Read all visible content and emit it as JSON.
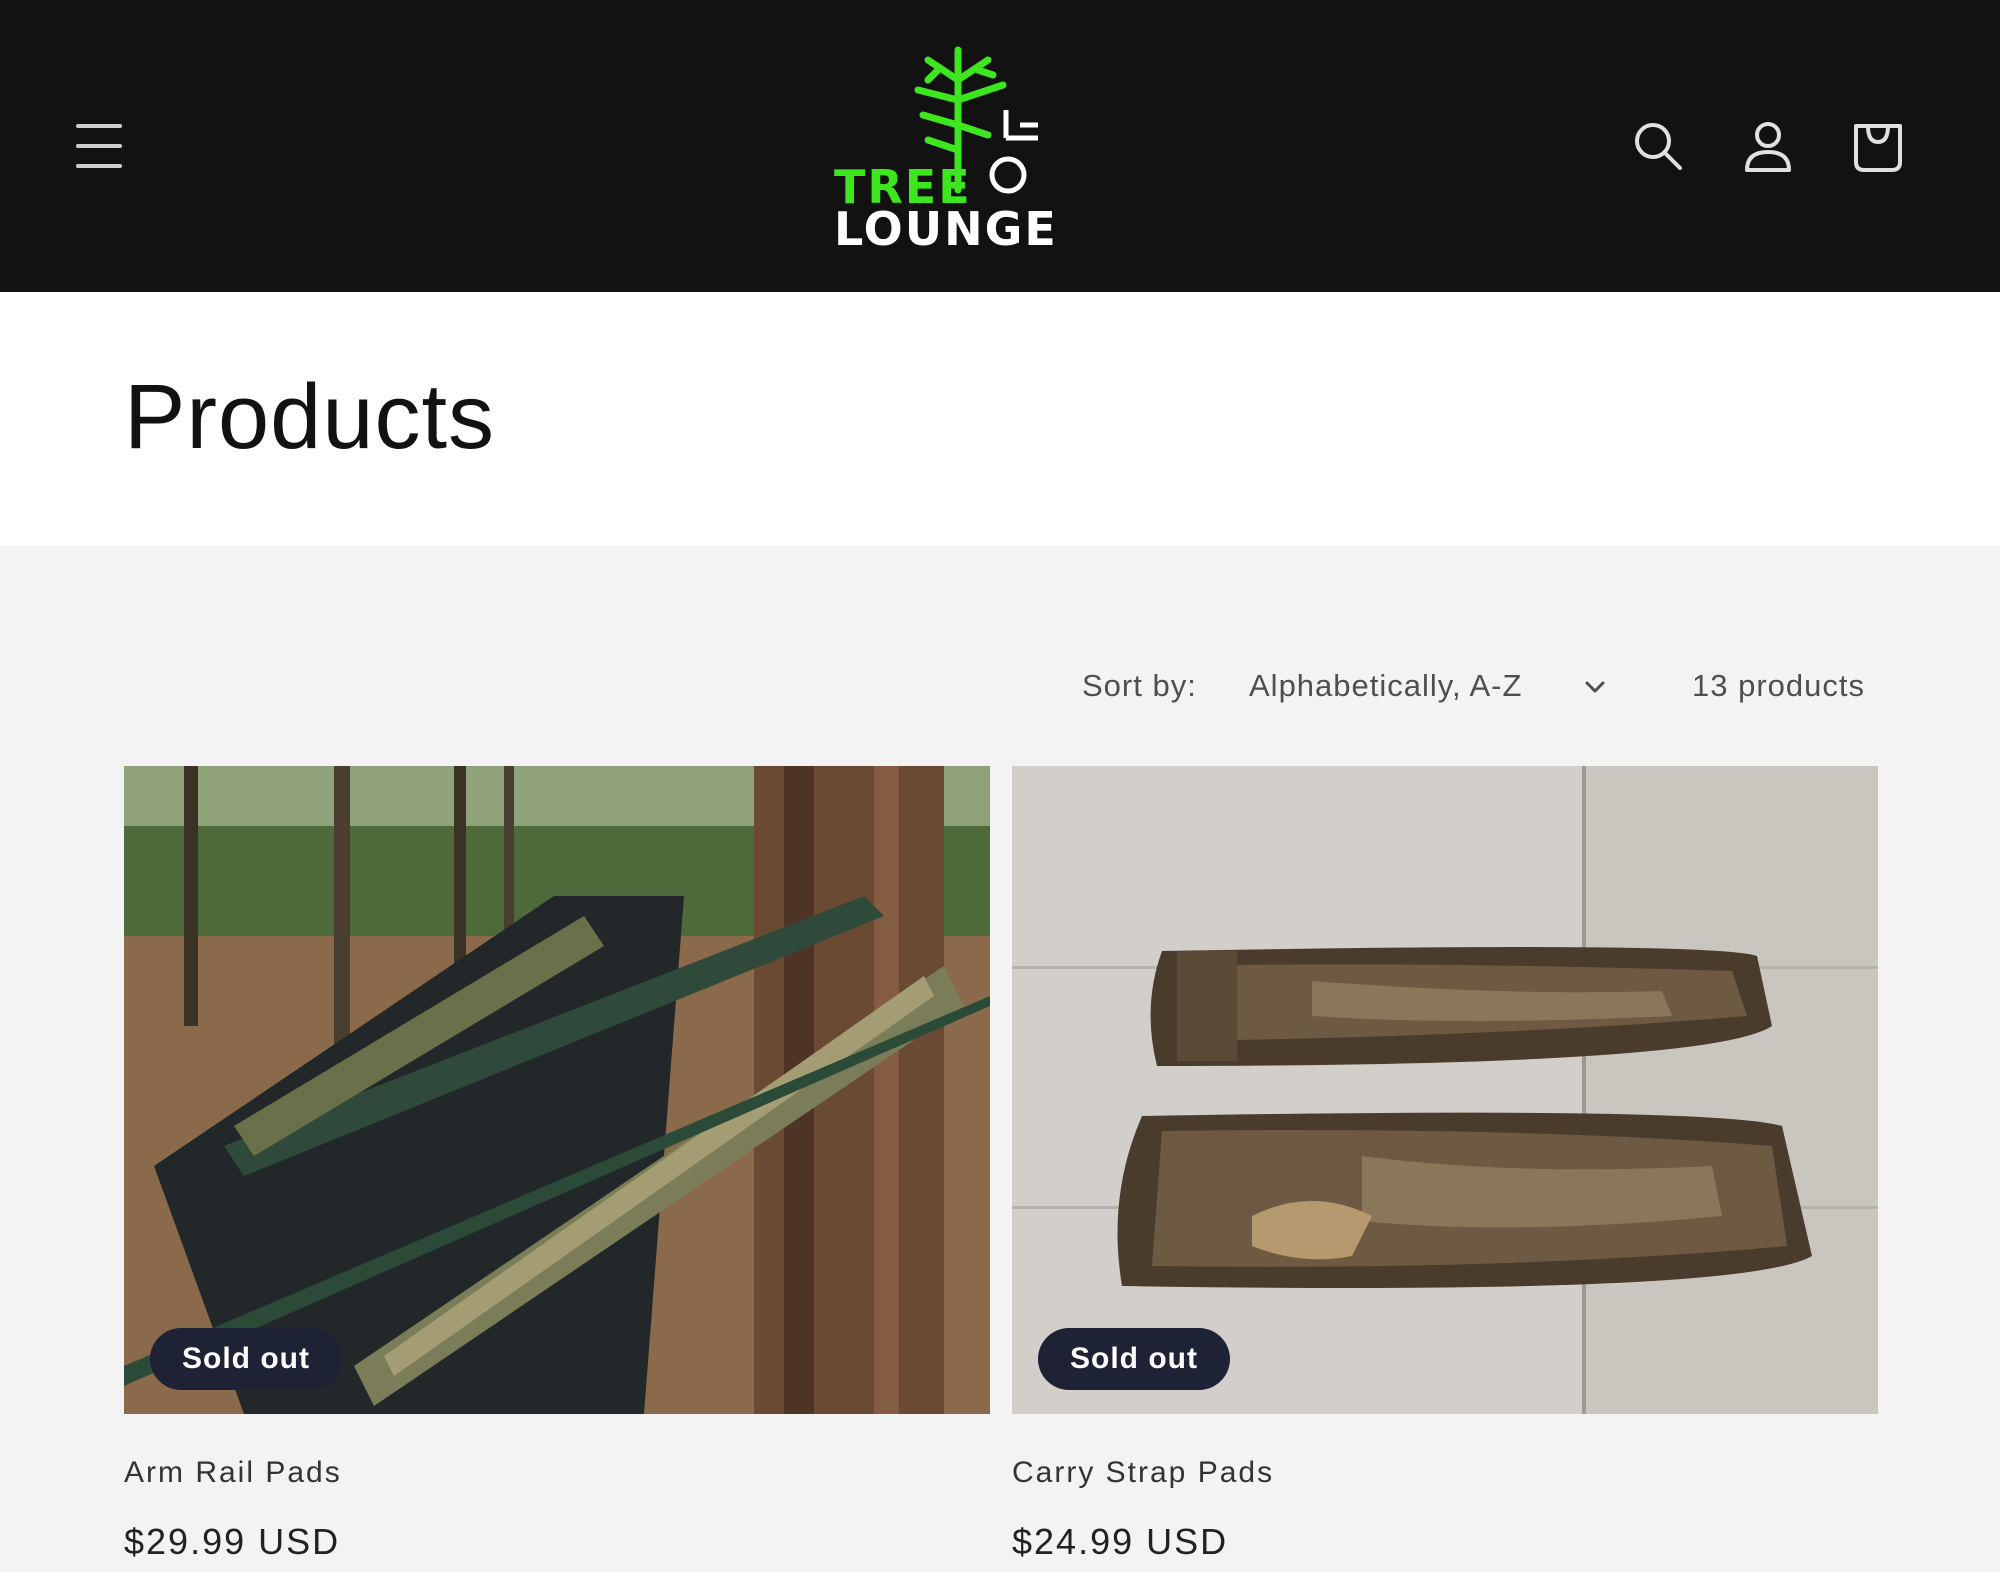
{
  "header": {
    "logo": {
      "line1": "TREE",
      "line2": "LOUNGE"
    },
    "icons": [
      "menu-icon",
      "search-icon",
      "account-icon",
      "cart-icon"
    ],
    "colors": {
      "background": "#121212",
      "brand_green": "#3ee61f"
    }
  },
  "page": {
    "title": "Products"
  },
  "toolbar": {
    "sort_label": "Sort by:",
    "sort_value": "Alphabetically, A-Z",
    "count": "13 products"
  },
  "products": [
    {
      "title": "Arm Rail Pads",
      "price": "$29.99 USD",
      "badge": "Sold out"
    },
    {
      "title": "Carry Strap Pads",
      "price": "$24.99 USD",
      "badge": "Sold out"
    }
  ]
}
